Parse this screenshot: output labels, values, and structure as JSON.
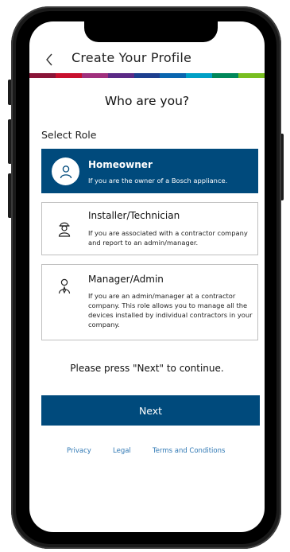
{
  "header": {
    "title": "Create Your Profile",
    "back_icon": "chevron-left-icon"
  },
  "brand_colors": [
    "#8a1538",
    "#c8102e",
    "#a0307d",
    "#5b2a86",
    "#1d3f8f",
    "#0a66b0",
    "#00a0c6",
    "#00885a",
    "#78be20"
  ],
  "main": {
    "question": "Who are you?",
    "select_label": "Select Role",
    "roles": [
      {
        "title": "Homeowner",
        "description": "If you are the owner of a Bosch appliance.",
        "icon": "person-icon",
        "selected": true
      },
      {
        "title": "Installer/Technician",
        "description": "If you are associated with a contractor company and report to an admin/manager.",
        "icon": "technician-icon",
        "selected": false
      },
      {
        "title": "Manager/Admin",
        "description": "If you are an admin/manager at a contractor company. This role allows you to manage all the devices installed by individual contractors in your company.",
        "icon": "manager-icon",
        "selected": false
      }
    ],
    "continue_text": "Please press \"Next\" to continue.",
    "next_label": "Next"
  },
  "footer": {
    "privacy": "Privacy",
    "legal": "Legal",
    "terms": "Terms and Conditions"
  },
  "colors": {
    "primary": "#004a7c",
    "link": "#2f78b4"
  }
}
